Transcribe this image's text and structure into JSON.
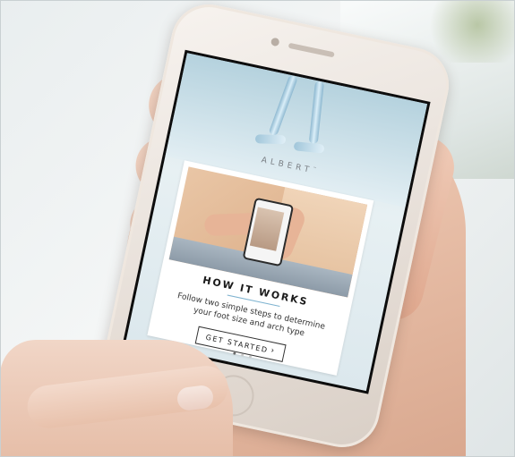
{
  "app": {
    "brand": "ALBERT",
    "trademark": "™"
  },
  "card": {
    "title": "HOW IT WORKS",
    "description": "Follow two simple steps to determine your foot size and arch type",
    "pagination": {
      "total": 3,
      "active_index": 0
    }
  },
  "cta": {
    "label": "GET STARTED",
    "chevron": "›"
  },
  "colors": {
    "accent_rule": "#7fb3d0",
    "cta_border": "#333333",
    "screen_bg": "#dce8ed"
  }
}
